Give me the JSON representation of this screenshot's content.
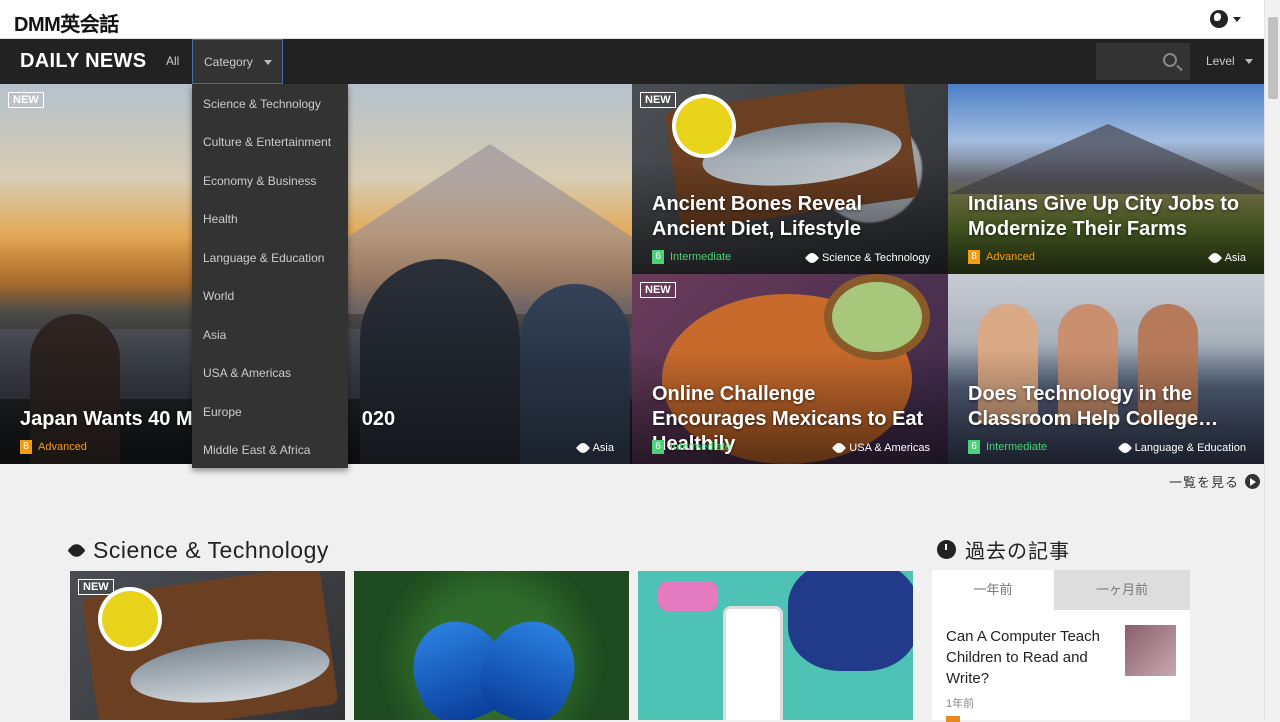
{
  "header": {
    "logo": "DMM英会話"
  },
  "nav": {
    "title": "DAILY NEWS",
    "all": "All",
    "category": "Category",
    "level": "Level"
  },
  "dropdown": {
    "items": [
      "Science & Technology",
      "Culture & Entertainment",
      "Economy & Business",
      "Health",
      "Language & Education",
      "World",
      "Asia",
      "USA & Americas",
      "Europe",
      "Middle East & Africa"
    ]
  },
  "colors": {
    "advanced": "#f39c12",
    "intermediate": "#4cd17a",
    "accent_border": "#4a6fa5"
  },
  "hero": {
    "new_label": "NEW",
    "main": {
      "title_left": "Japan Wants 40 Mil",
      "title_right": "020",
      "level_num": "8",
      "level": "Advanced",
      "tag": "Asia"
    },
    "tiles": [
      {
        "title": "Ancient Bones Reveal Ancient Diet, Lifestyle",
        "level_num": "6",
        "level": "Intermediate",
        "tag": "Science & Technology",
        "new": true
      },
      {
        "title": "Indians Give Up City Jobs to Modernize Their Farms",
        "level_num": "8",
        "level": "Advanced",
        "tag": "Asia",
        "new": false
      },
      {
        "title": "Online Challenge Encourages Mexicans to Eat Healthily",
        "level_num": "6",
        "level": "Intermediate",
        "tag": "USA & Americas",
        "new": true
      },
      {
        "title": "Does Technology in the Classroom Help College Stud...",
        "level_num": "6",
        "level": "Intermediate",
        "tag": "Language & Education",
        "new": false
      }
    ]
  },
  "see_all": "一覧を見る",
  "section": {
    "title": "Science & Technology",
    "new_label": "NEW"
  },
  "sidebar": {
    "title": "過去の記事",
    "tab_year": "一年前",
    "tab_month": "一ヶ月前",
    "article_title": "Can A Computer Teach Children to Read and Write?",
    "article_ago": "1年前"
  }
}
